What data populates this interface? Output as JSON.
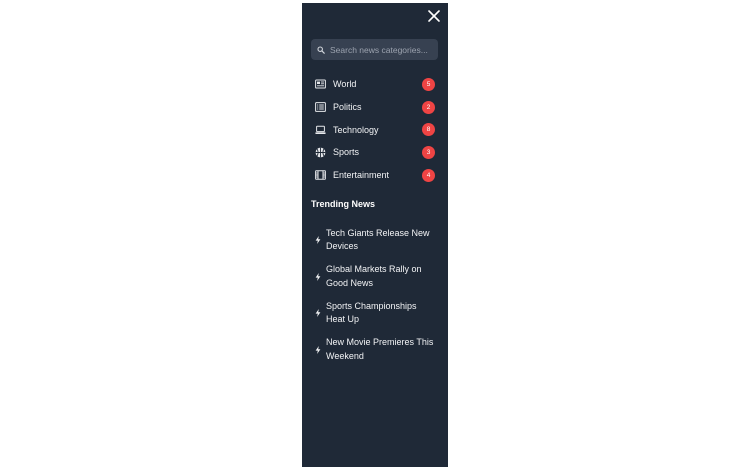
{
  "sidebar": {
    "close_label": "Close menu",
    "search": {
      "placeholder": "Search news categories...",
      "value": ""
    },
    "categories": [
      {
        "label": "World",
        "count": "5",
        "icon": "newspaper-icon"
      },
      {
        "label": "Politics",
        "count": "2",
        "icon": "document-list-icon"
      },
      {
        "label": "Technology",
        "count": "8",
        "icon": "laptop-icon"
      },
      {
        "label": "Sports",
        "count": "3",
        "icon": "basketball-icon"
      },
      {
        "label": "Entertainment",
        "count": "4",
        "icon": "film-icon"
      }
    ],
    "trending": {
      "title": "Trending News",
      "items": [
        {
          "line1": "Tech Giants Release New",
          "line2": "Devices"
        },
        {
          "line1": "Global Markets Rally on",
          "line2": "Good News"
        },
        {
          "line1": "Sports Championships",
          "line2": "Heat Up"
        },
        {
          "line1": "New Movie Premieres This",
          "line2": "Weekend"
        }
      ]
    }
  },
  "colors": {
    "sidebar_bg": "#1f2937",
    "search_bg": "#374151",
    "badge_bg": "#ef4444",
    "text": "#f3f4f6"
  }
}
